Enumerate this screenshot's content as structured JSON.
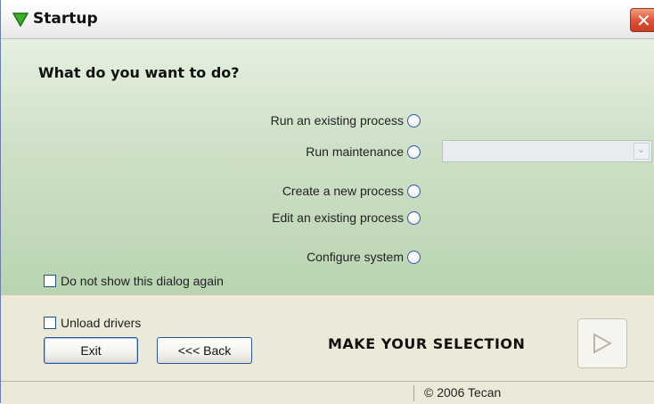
{
  "window": {
    "title": "Startup",
    "close_symbol": "✕",
    "title_icon": "green-down-triangle-icon"
  },
  "main": {
    "question": "What do you want to do?",
    "options": [
      {
        "label": "Run an existing process"
      },
      {
        "label": "Run maintenance"
      },
      {
        "label": "Create a new process"
      },
      {
        "label": "Edit an existing process"
      },
      {
        "label": "Configure system"
      }
    ],
    "maintenance_select": {
      "value": "",
      "enabled": false
    },
    "dont_show_label": "Do not show this dialog again"
  },
  "bottom": {
    "unload_drivers_label": "Unload drivers",
    "exit_label": "Exit",
    "back_label": "<<< Back",
    "make_selection": "MAKE YOUR SELECTION",
    "next_icon": "play-triangle-icon"
  },
  "status": {
    "copyright": "© 2006 Tecan"
  },
  "colors": {
    "panel_green": "#cfe1c8",
    "bottom_bg": "#ece9d8",
    "accent_blue": "#2d5390"
  }
}
